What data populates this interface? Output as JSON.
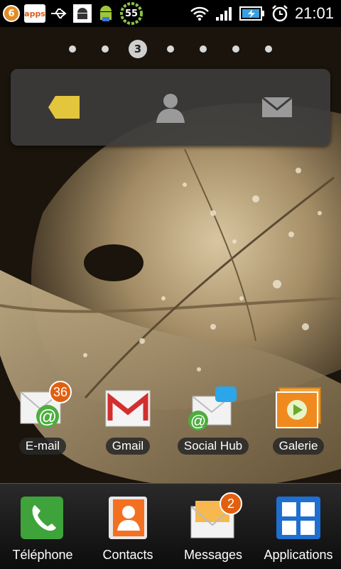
{
  "status_bar": {
    "notification_count": "6",
    "apps_badge": "apps",
    "battery_widget_value": "55",
    "time": "21:01"
  },
  "pager": {
    "current_page": "3",
    "page_count": 7
  },
  "widget": {
    "buttons": [
      "note-icon",
      "contact-icon",
      "mail-icon"
    ]
  },
  "home_apps": [
    {
      "label": "E-mail",
      "badge": "36",
      "icon": "email-icon"
    },
    {
      "label": "Gmail",
      "badge": "",
      "icon": "gmail-icon"
    },
    {
      "label": "Social Hub",
      "badge": "",
      "icon": "social-hub-icon"
    },
    {
      "label": "Galerie",
      "badge": "",
      "icon": "gallery-icon"
    }
  ],
  "dock": [
    {
      "label": "Téléphone",
      "badge": "",
      "icon": "phone-icon"
    },
    {
      "label": "Contacts",
      "badge": "",
      "icon": "contacts-icon"
    },
    {
      "label": "Messages",
      "badge": "2",
      "icon": "messages-icon"
    },
    {
      "label": "Applications",
      "badge": "",
      "icon": "applications-icon"
    }
  ],
  "colors": {
    "badge": "#e06010",
    "sepia_light": "#d7c39a",
    "sepia_dark": "#2a1f12"
  }
}
